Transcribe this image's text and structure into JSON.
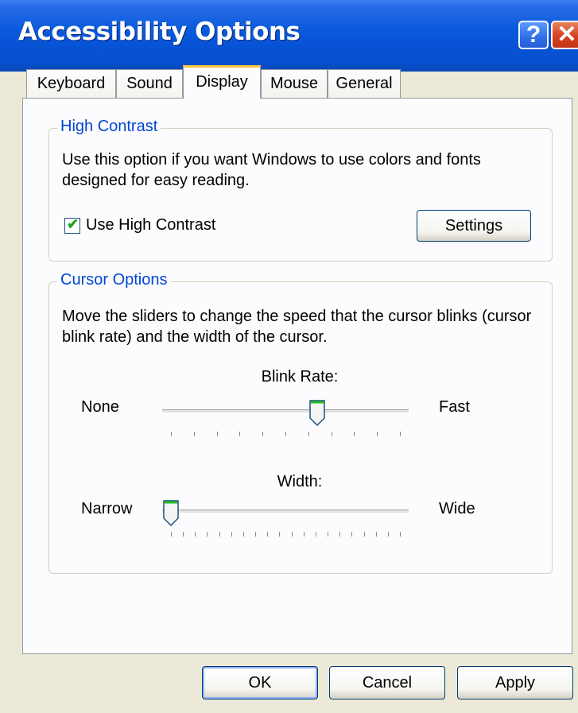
{
  "window": {
    "title": "Accessibility Options",
    "help_glyph": "?",
    "close_glyph": "✕"
  },
  "tabs": [
    {
      "label": "Keyboard",
      "active": false
    },
    {
      "label": "Sound",
      "active": false
    },
    {
      "label": "Display",
      "active": true
    },
    {
      "label": "Mouse",
      "active": false
    },
    {
      "label": "General",
      "active": false
    }
  ],
  "high_contrast": {
    "legend": "High Contrast",
    "description": "Use this option if you want Windows to use colors and fonts designed for easy reading.",
    "checkbox_label": "Use High Contrast",
    "checked": true,
    "settings_label": "Settings"
  },
  "cursor_options": {
    "legend": "Cursor Options",
    "description": "Move the sliders to change the speed that the cursor blinks (cursor blink rate) and the width of the cursor.",
    "blink_rate": {
      "label": "Blink Rate:",
      "min_label": "None",
      "max_label": "Fast",
      "value_fraction": 0.64
    },
    "width": {
      "label": "Width:",
      "min_label": "Narrow",
      "max_label": "Wide",
      "value_fraction": 0.0
    }
  },
  "footer": {
    "ok_label": "OK",
    "cancel_label": "Cancel",
    "apply_label": "Apply"
  },
  "icons": {
    "checkbox_check": "check-icon",
    "help": "help-icon",
    "close": "close-icon",
    "slider_thumb": "slider-thumb-icon"
  },
  "colors": {
    "titlebar": "#0a5bdc",
    "active_tab_highlight": "#ffc83c",
    "group_legend": "#0046d5",
    "close_button": "#d6411e",
    "checkmark": "#21a121"
  }
}
